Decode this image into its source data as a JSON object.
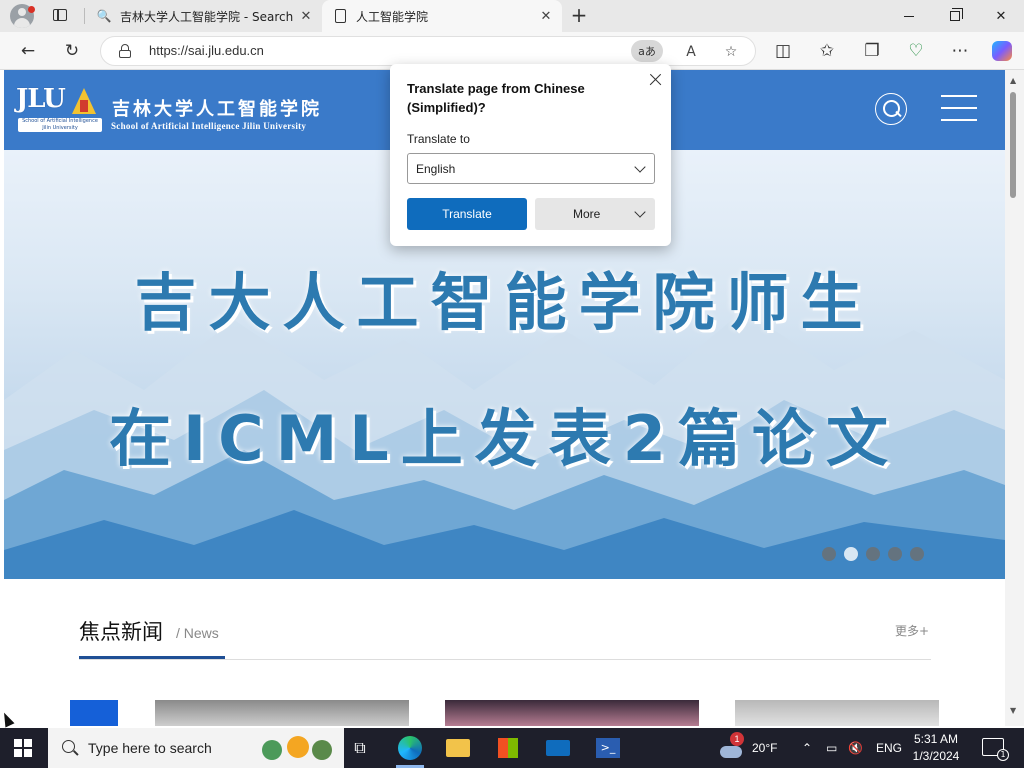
{
  "browser": {
    "tabs": [
      {
        "label": "吉林大学人工智能学院 - Search",
        "close": "✕"
      },
      {
        "label": "人工智能学院",
        "close": "✕"
      }
    ],
    "new_tab": "+",
    "url": "https://sai.jlu.edu.cn",
    "translate_chip": "aあ"
  },
  "site": {
    "logo_letters": "JLU",
    "logo_small": "School of Artificial Intelligence Jilin University",
    "name_cn": "吉林大学人工智能学院",
    "name_en": "School of Artificial Intelligence Jilin University",
    "banner_line_1": "吉大人工智能学院师生",
    "banner_line_2": "在ICML上发表2篇论文",
    "carousel": {
      "count": 5,
      "active_index": 1
    },
    "news": {
      "title": "焦点新闻",
      "subtitle": "/ News",
      "more": "更多+"
    }
  },
  "translate_popup": {
    "title": "Translate page from Chinese (Simplified)?",
    "label": "Translate to",
    "selected_language": "English",
    "translate_button": "Translate",
    "more_button": "More"
  },
  "taskbar": {
    "search_placeholder": "Type here to search",
    "weather_temp": "20°F",
    "weather_badge": "1",
    "language": "ENG",
    "time": "5:31 AM",
    "date": "1/3/2024",
    "notification_count": "1"
  },
  "colors": {
    "header_blue": "#3a7ac9",
    "banner_text": "#2d7ab0",
    "accent": "#0f6cbd"
  }
}
